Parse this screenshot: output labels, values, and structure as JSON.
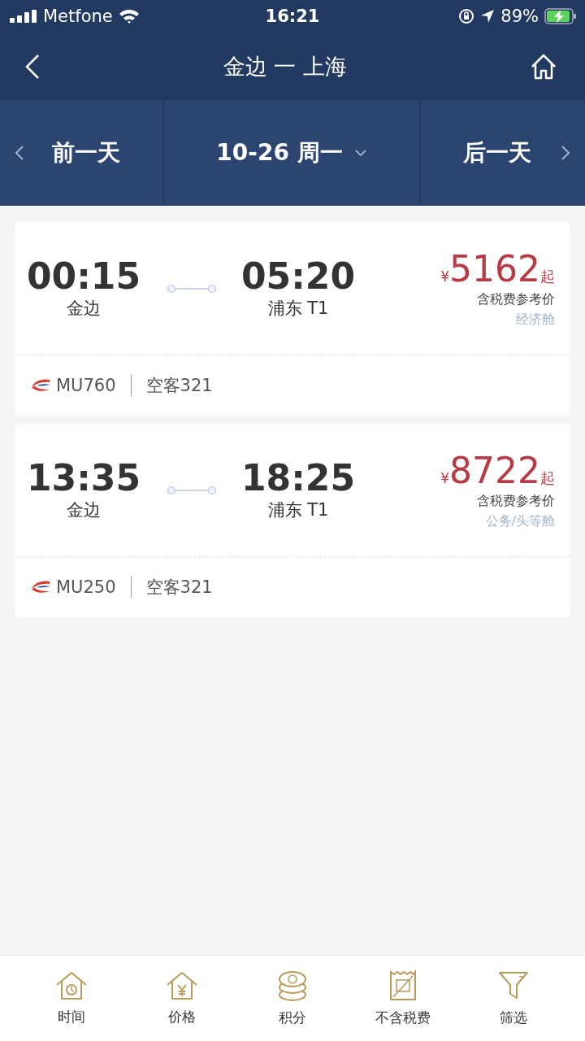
{
  "status_bar": {
    "carrier": "Metfone",
    "time": "16:21",
    "battery": "89%"
  },
  "nav": {
    "title": "金边 一 上海"
  },
  "date_bar": {
    "prev": "前一天",
    "current": "10-26 周一",
    "next": "后一天"
  },
  "flights": [
    {
      "depart_time": "00:15",
      "depart_airport": "金边",
      "arrive_time": "05:20",
      "arrive_airport": "浦东 T1",
      "currency": "¥",
      "price": "5162",
      "price_suffix": "起",
      "price_note": "含税费参考价",
      "cabin": "经济舱",
      "flight_no": "MU760",
      "aircraft": "空客321"
    },
    {
      "depart_time": "13:35",
      "depart_airport": "金边",
      "arrive_time": "18:25",
      "arrive_airport": "浦东 T1",
      "currency": "¥",
      "price": "8722",
      "price_suffix": "起",
      "price_note": "含税费参考价",
      "cabin": "公务/头等舱",
      "flight_no": "MU250",
      "aircraft": "空客321"
    }
  ],
  "tab_bar": [
    {
      "kind": "time",
      "label": "时间"
    },
    {
      "kind": "price",
      "label": "价格"
    },
    {
      "kind": "points",
      "label": "积分"
    },
    {
      "kind": "tax",
      "label": "不含税费"
    },
    {
      "kind": "filter",
      "label": "筛选"
    }
  ]
}
